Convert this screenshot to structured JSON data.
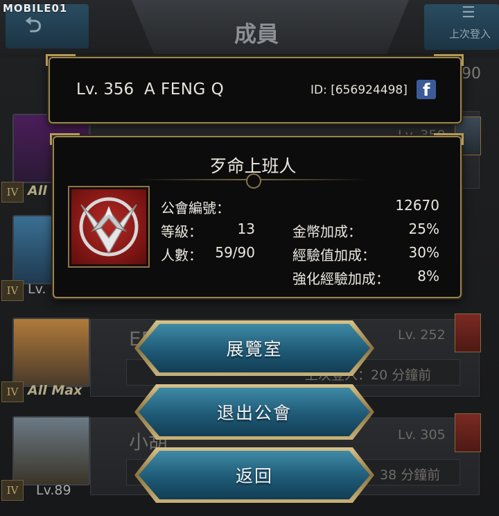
{
  "watermark": "MOBILE01",
  "background": {
    "page_title": "成員",
    "last_login_label": "上次登入",
    "member_count": "90",
    "rows": [
      {
        "avatar_tag": "All",
        "level": "Lv. 350"
      },
      {
        "avatar_tag": "Lv.",
        "level": ""
      },
      {
        "avatar_tag": "All Max",
        "name": "EE",
        "level": "Lv. 252",
        "sub": "上次登入：20 分鐘前"
      },
      {
        "avatar_tag": "Lv.89",
        "name": "小胡",
        "level": "Lv. 305",
        "sub": "38 分鐘前"
      }
    ],
    "rank_numeral": "IV"
  },
  "player": {
    "level": "Lv. 356",
    "name": "A FENG Q",
    "id": "ID: [656924498]",
    "facebook_icon": "facebook-icon"
  },
  "guild": {
    "name": "歹命上班人",
    "emblem_icon": "guild-emblem-icon",
    "stats": {
      "guild_number_label": "公會編號：",
      "guild_number_value": "12670",
      "grade_label": "等級：",
      "grade_value": "13",
      "members_label": "人數：",
      "members_value": "59/90",
      "gold_bonus_label": "金幣加成：",
      "gold_bonus_value": "25%",
      "exp_bonus_label": "經驗值加成：",
      "exp_bonus_value": "30%",
      "enhance_exp_bonus_label": "強化經驗加成：",
      "enhance_exp_bonus_value": "8%"
    }
  },
  "actions": {
    "gallery": "展覽室",
    "leave_guild": "退出公會",
    "back": "返回"
  },
  "colors": {
    "gold_border": "#9a8550",
    "button_blue": "#1f5a76",
    "emblem_red": "#7b1513",
    "facebook_blue": "#3b5b98"
  }
}
